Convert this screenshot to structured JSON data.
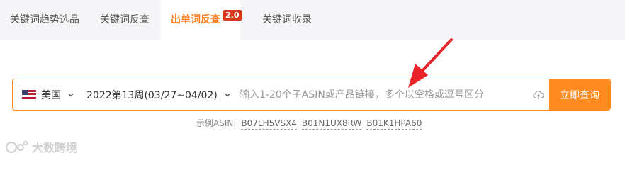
{
  "tabs": [
    {
      "label": "关键词趋势选品",
      "active": false
    },
    {
      "label": "关键词反查",
      "active": false
    },
    {
      "label": "出单词反查",
      "active": true,
      "badge": "2.0"
    },
    {
      "label": "关键词收录",
      "active": false
    }
  ],
  "search": {
    "country": "美国",
    "week": "2022第13周(03/27~04/02)",
    "placeholder": "输入1-20个子ASIN或产品链接，多个以空格或逗号区分",
    "submit_label": "立即查询"
  },
  "examples": {
    "label": "示例ASIN:",
    "asins": [
      "B07LH5VSX4",
      "B01N1UX8RW",
      "B01K1HPA60"
    ]
  },
  "watermark": "大数跨境",
  "colors": {
    "accent": "#ff8a1f",
    "badge": "#d9371c",
    "arrow": "#e8232a"
  }
}
